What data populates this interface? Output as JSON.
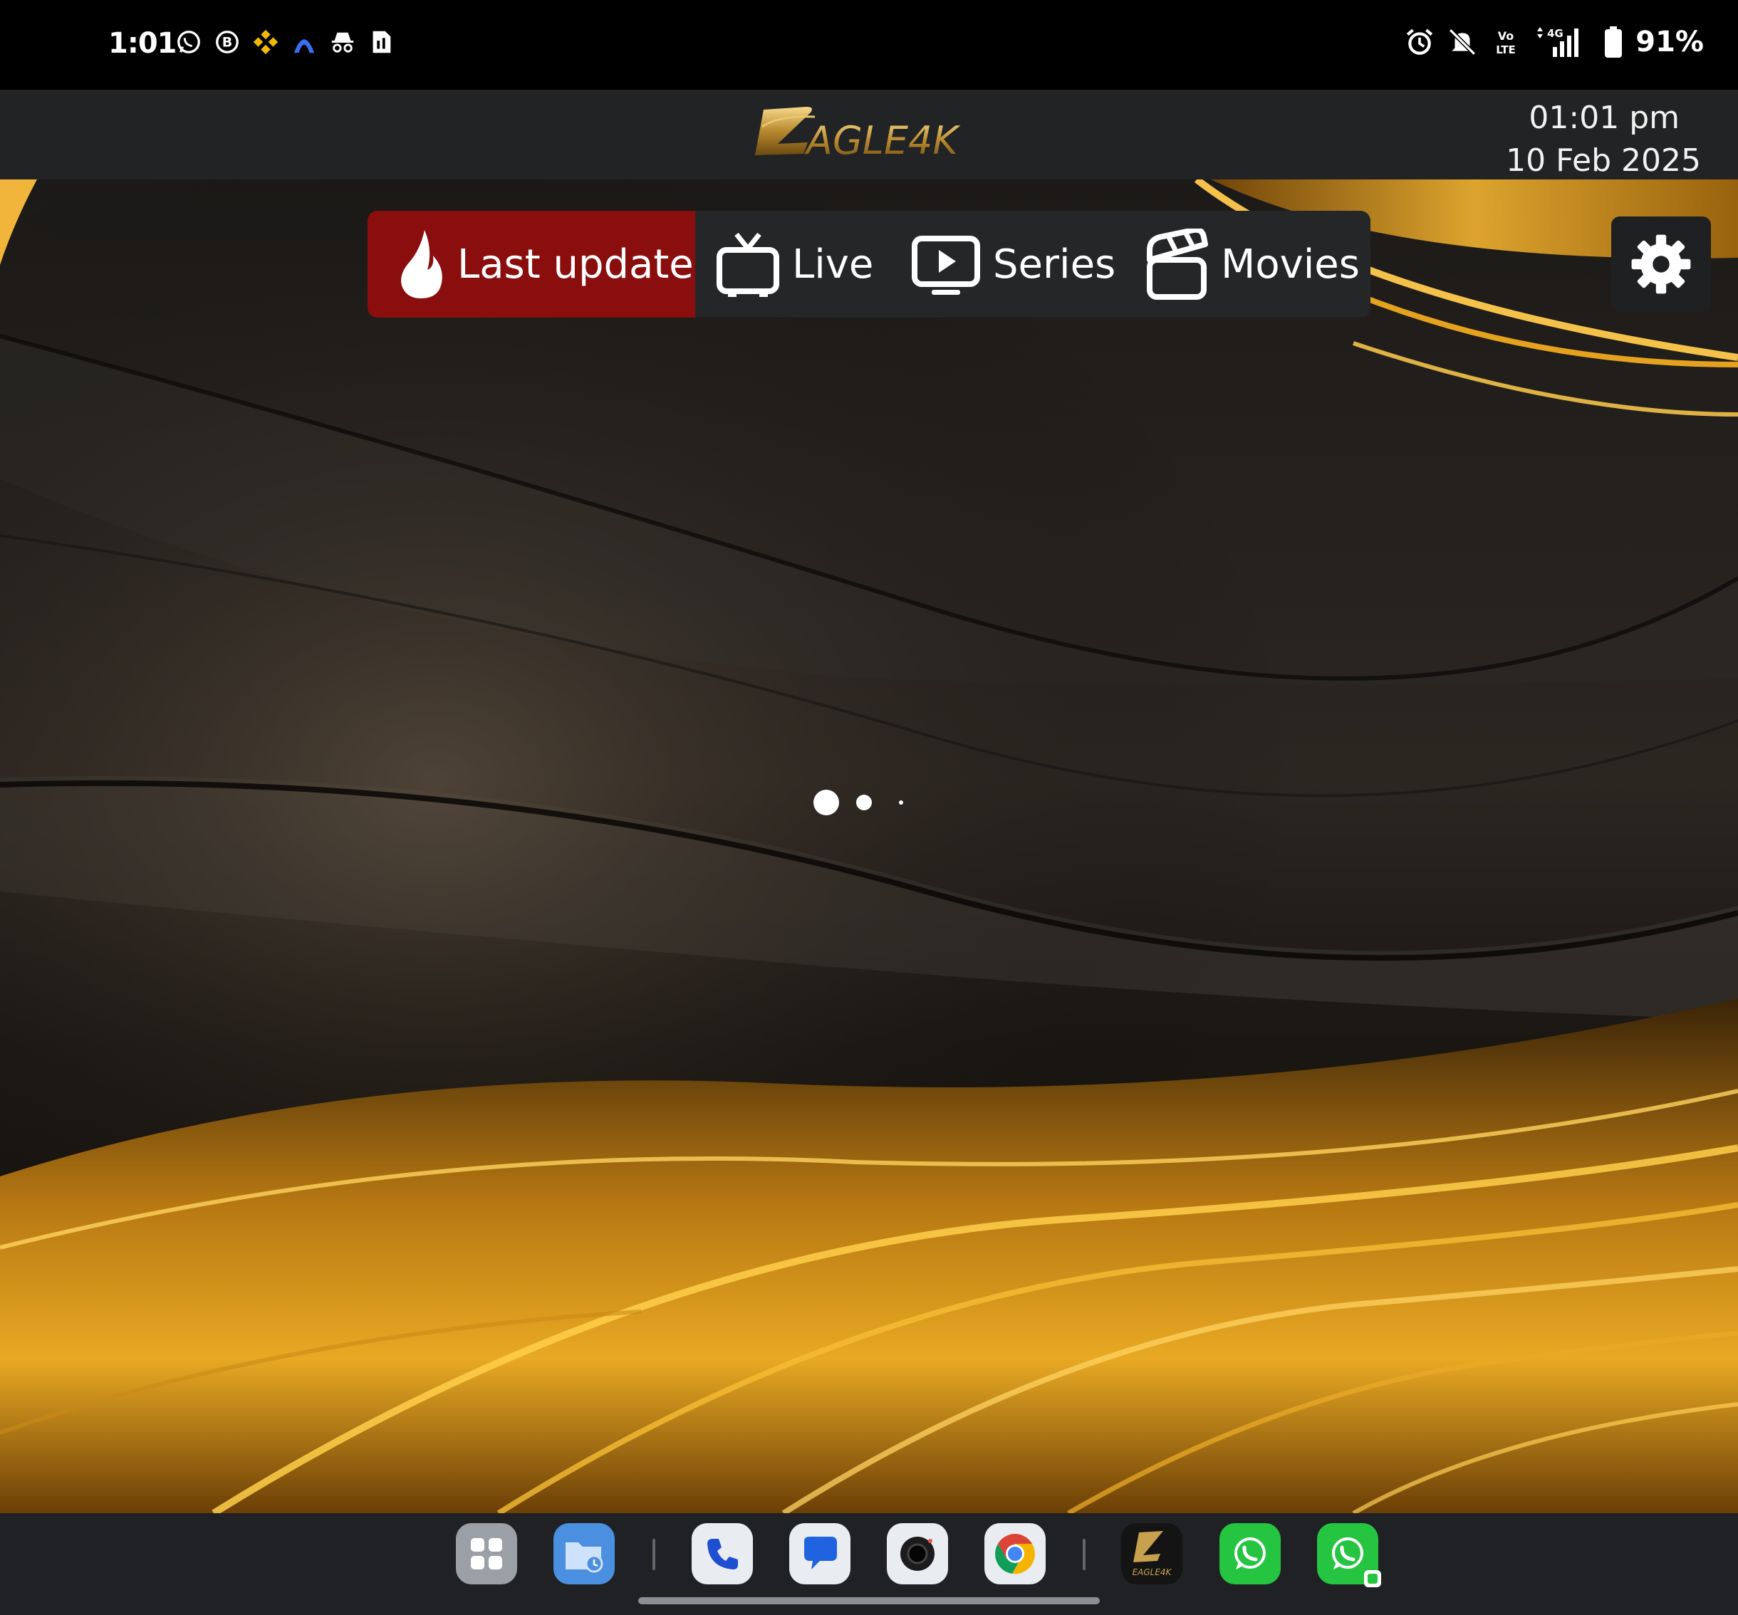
{
  "status_bar": {
    "time": "1:01",
    "battery": "91%",
    "left_icons": [
      "whatsapp-icon",
      "b-badge-icon",
      "binance-icon",
      "arch-app-icon",
      "incognito-icon",
      "sim-card-icon"
    ],
    "right_icons": [
      "alarm-icon",
      "mute-bell-icon",
      "volte-icon",
      "signal-4g-icon",
      "battery-icon"
    ]
  },
  "header": {
    "logo_text": "AGLE4K",
    "time": "01:01 pm",
    "date": "10 Feb 2025"
  },
  "nav": {
    "tabs": [
      {
        "label": "Last update",
        "icon": "flame-icon",
        "active": true
      },
      {
        "label": "Live",
        "icon": "tv-icon",
        "active": false
      },
      {
        "label": "Series",
        "icon": "play-screen-icon",
        "active": false
      },
      {
        "label": "Movies",
        "icon": "clapperboard-icon",
        "active": false
      }
    ],
    "settings_icon": "gear-icon"
  },
  "colors": {
    "active_tab": "#8b0e0e",
    "nav_bg": "#252628",
    "header_bg": "#222324",
    "gold": "#d89a1a"
  },
  "taskbar": {
    "apps": [
      "apps-grid",
      "files",
      "phone",
      "messages",
      "camera",
      "chrome",
      "eagle4k",
      "whatsapp",
      "whatsapp-business"
    ],
    "eagle_label": "EAGLE4K"
  }
}
